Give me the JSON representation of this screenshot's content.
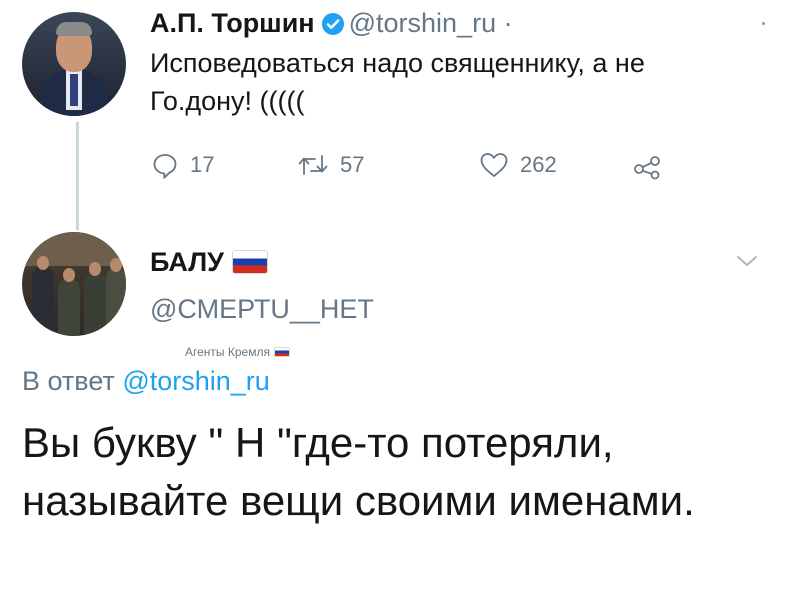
{
  "tweet1": {
    "author_name": "А.П. Торшин",
    "verified": true,
    "handle": "@torshin_ru",
    "separator": "·",
    "text": "Исповедоваться надо священнику, а не Го.дону! (((((",
    "actions": {
      "reply_count": "17",
      "retweet_count": "57",
      "like_count": "262"
    },
    "icons": [
      "reply-icon",
      "retweet-icon",
      "heart-icon",
      "share-icon",
      "verified-badge-icon"
    ]
  },
  "tweet2": {
    "author_name": "БАЛУ",
    "author_flag": "russian-flag-icon",
    "handle": "@СМЕРТU__НЕТ",
    "bio": "Агенты Кремля",
    "reply_prefix": "В ответ",
    "reply_handle": "@torshin_ru",
    "text": "Вы букву \" Н \"где-то потеряли, называйте вещи своими именами.",
    "icons": [
      "chevron-down-icon"
    ]
  },
  "colors": {
    "text": "#14171a",
    "secondary": "#657786",
    "link": "#1da1f2",
    "thread_line": "#ccd6dd",
    "verified": "#1da1f2"
  }
}
